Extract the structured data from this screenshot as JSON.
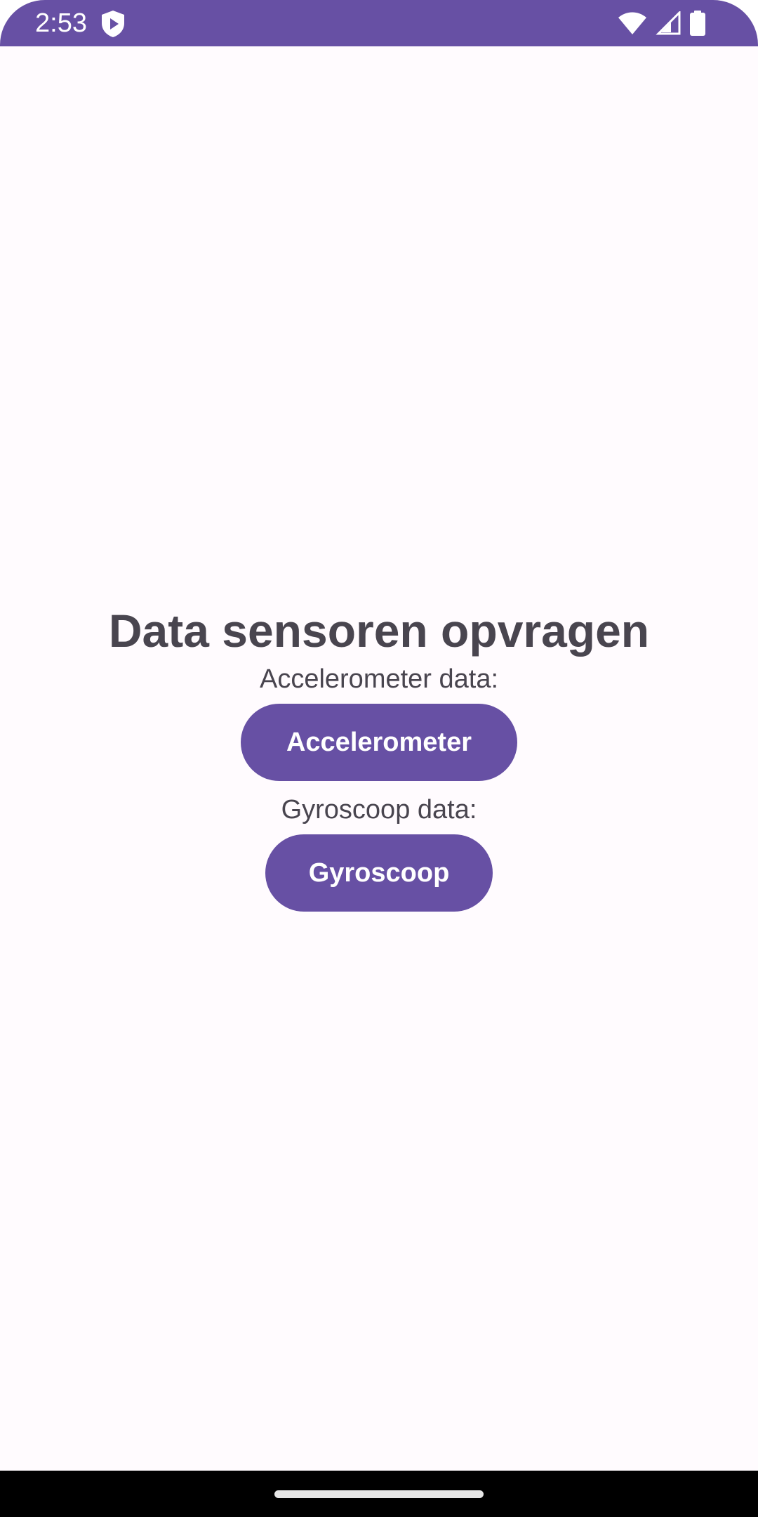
{
  "status_bar": {
    "time": "2:53",
    "icons": [
      "shield-play-icon",
      "wifi-icon",
      "cell-signal-icon",
      "battery-icon"
    ],
    "background": "#6750a4"
  },
  "main": {
    "title": "Data sensoren opvragen",
    "accelerometer": {
      "label": "Accelerometer data:",
      "button_label": "Accelerometer"
    },
    "gyroscope": {
      "label": "Gyroscoop data:",
      "button_label": "Gyroscoop"
    }
  },
  "colors": {
    "accent": "#6750a4",
    "text": "#49454f",
    "background": "#fffbfe"
  }
}
